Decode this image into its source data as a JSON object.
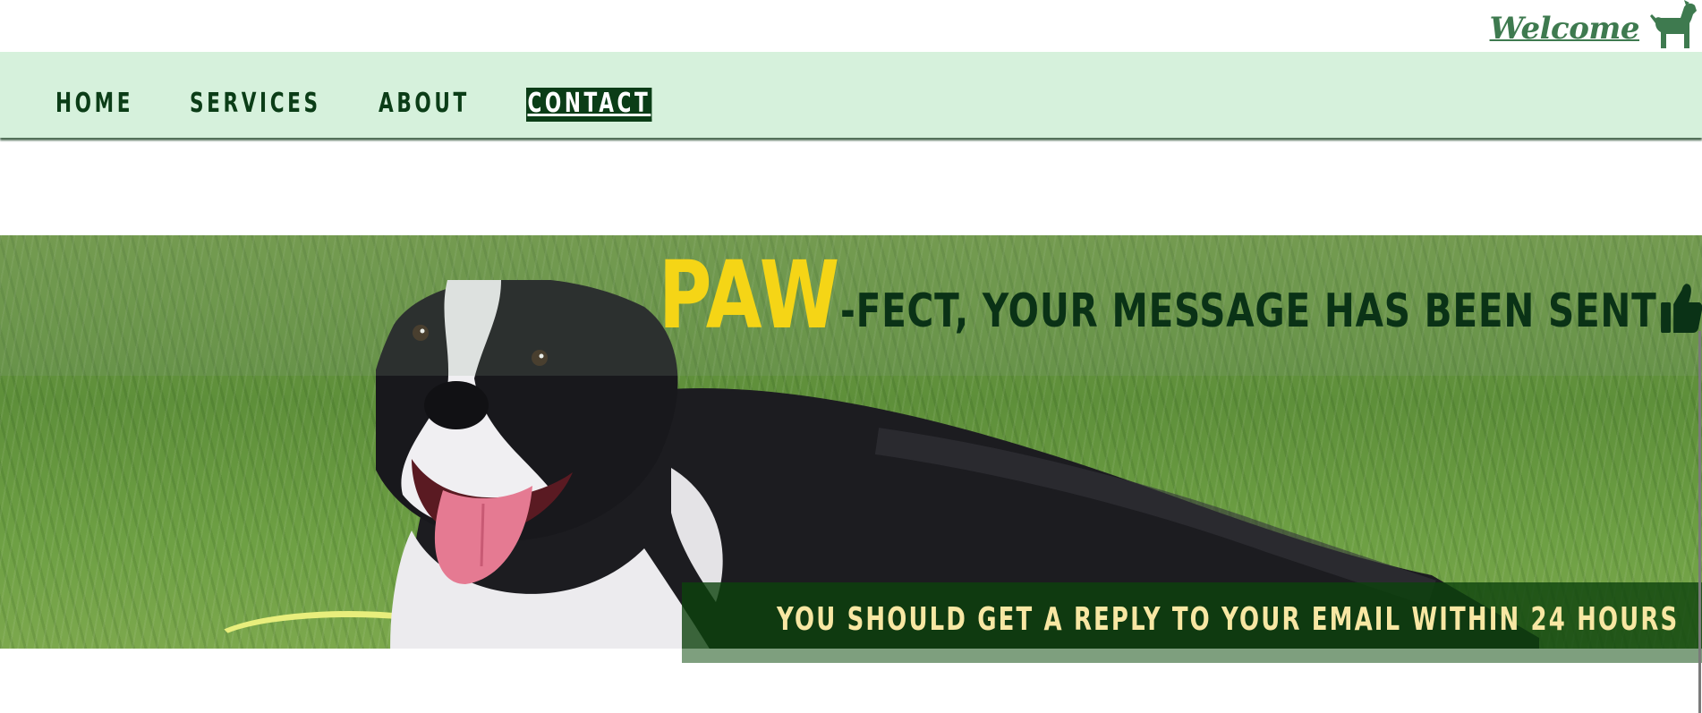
{
  "header": {
    "welcome_label": "Welcome",
    "logo_icon": "dog-icon"
  },
  "nav": {
    "items": [
      {
        "label": "HOME",
        "active": false
      },
      {
        "label": "SERVICES",
        "active": false
      },
      {
        "label": "ABOUT",
        "active": false
      },
      {
        "label": "CONTACT",
        "active": true
      }
    ]
  },
  "hero": {
    "headline_highlight": "PAW",
    "headline_rest": "-FECT, YOUR MESSAGE HAS BEEN SENT",
    "headline_icon": "thumbs-up-icon",
    "reply_message": "YOU SHOULD GET A REPLY TO YOUR EMAIL WITHIN 24 HOURS"
  },
  "colors": {
    "nav_background": "#d6f1dc",
    "nav_text": "#0b3d17",
    "accent_yellow": "#f5d516",
    "reply_text": "#f8e7a3",
    "brand_green": "#3e7a4f"
  }
}
